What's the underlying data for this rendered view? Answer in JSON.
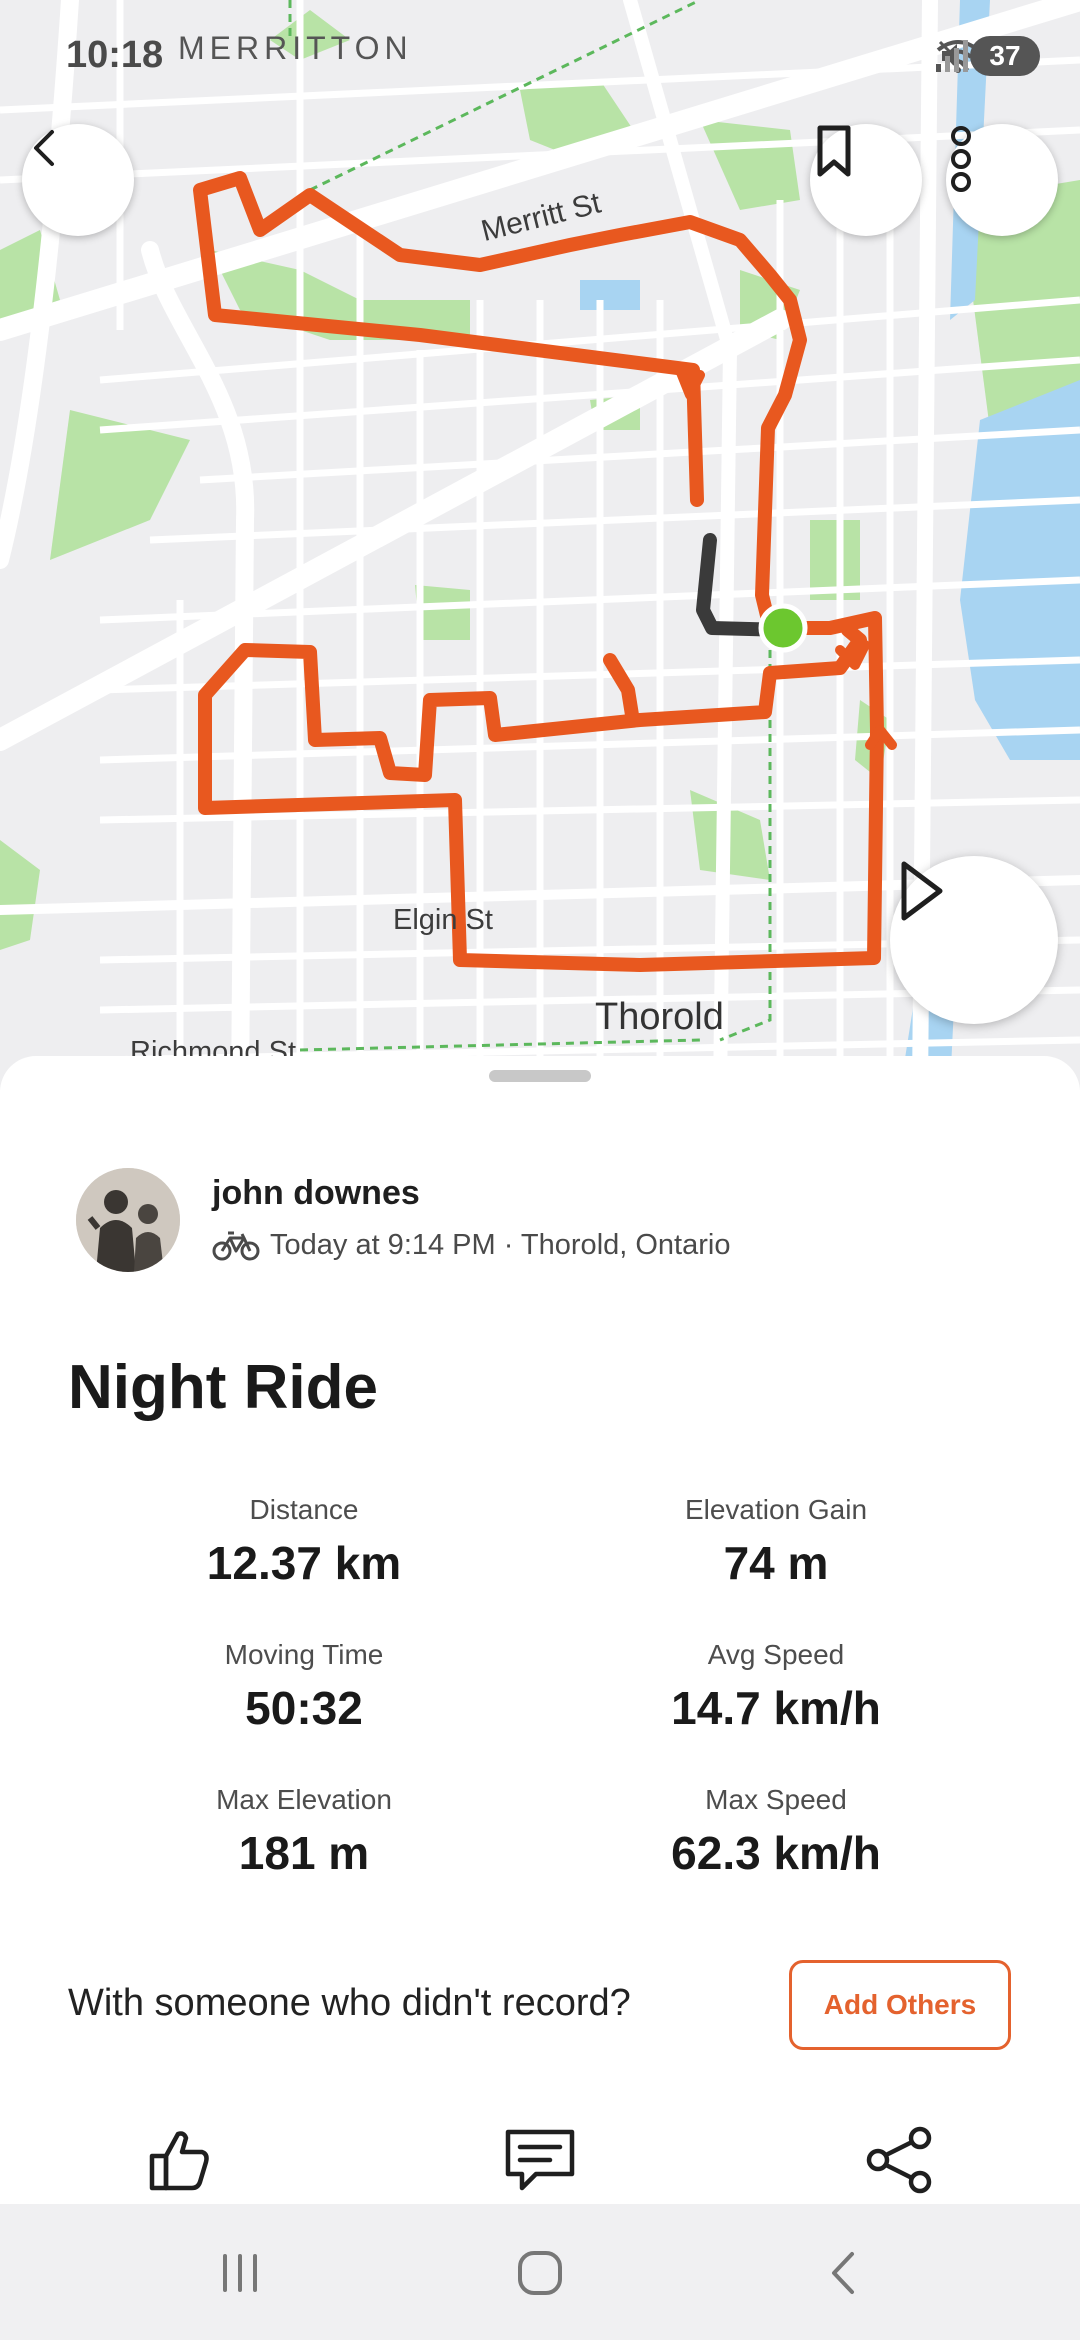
{
  "status_bar": {
    "time": "10:18",
    "battery": "37",
    "icons": [
      "mute-icon",
      "wifi-icon",
      "signal-icon",
      "battery-icon"
    ]
  },
  "map": {
    "labels": {
      "merritton": "MERRITTON",
      "merritt_st": "Merritt St",
      "elgin_st": "Elgin St",
      "thorold": "Thorold",
      "richmond_st": "Richmond St"
    },
    "route_color": "#e8581f",
    "start_marker_color": "#6cc72f",
    "buttons": [
      "back-icon",
      "bookmark-icon",
      "more-vertical-icon",
      "play-icon"
    ]
  },
  "activity": {
    "athlete_name": "john downes",
    "sport_icon": "bike-icon",
    "meta": "Today at 9:14 PM · Thorold, Ontario",
    "title": "Night Ride",
    "stats": [
      {
        "label": "Distance",
        "value": "12.37 km"
      },
      {
        "label": "Elevation Gain",
        "value": "74 m"
      },
      {
        "label": "Moving Time",
        "value": "50:32"
      },
      {
        "label": "Avg Speed",
        "value": "14.7 km/h"
      },
      {
        "label": "Max Elevation",
        "value": "181 m"
      },
      {
        "label": "Max Speed",
        "value": "62.3 km/h"
      }
    ]
  },
  "add_others": {
    "prompt": "With someone who didn't record?",
    "button_label": "Add Others"
  },
  "actions": [
    "kudos-icon",
    "comment-icon",
    "share-icon"
  ],
  "nav_bar": [
    "recents-icon",
    "home-icon",
    "back-icon"
  ],
  "colors": {
    "accent": "#e4622e",
    "map_background": "#eeeef0",
    "park": "#b8e3a6",
    "water": "#a8d4f2"
  }
}
